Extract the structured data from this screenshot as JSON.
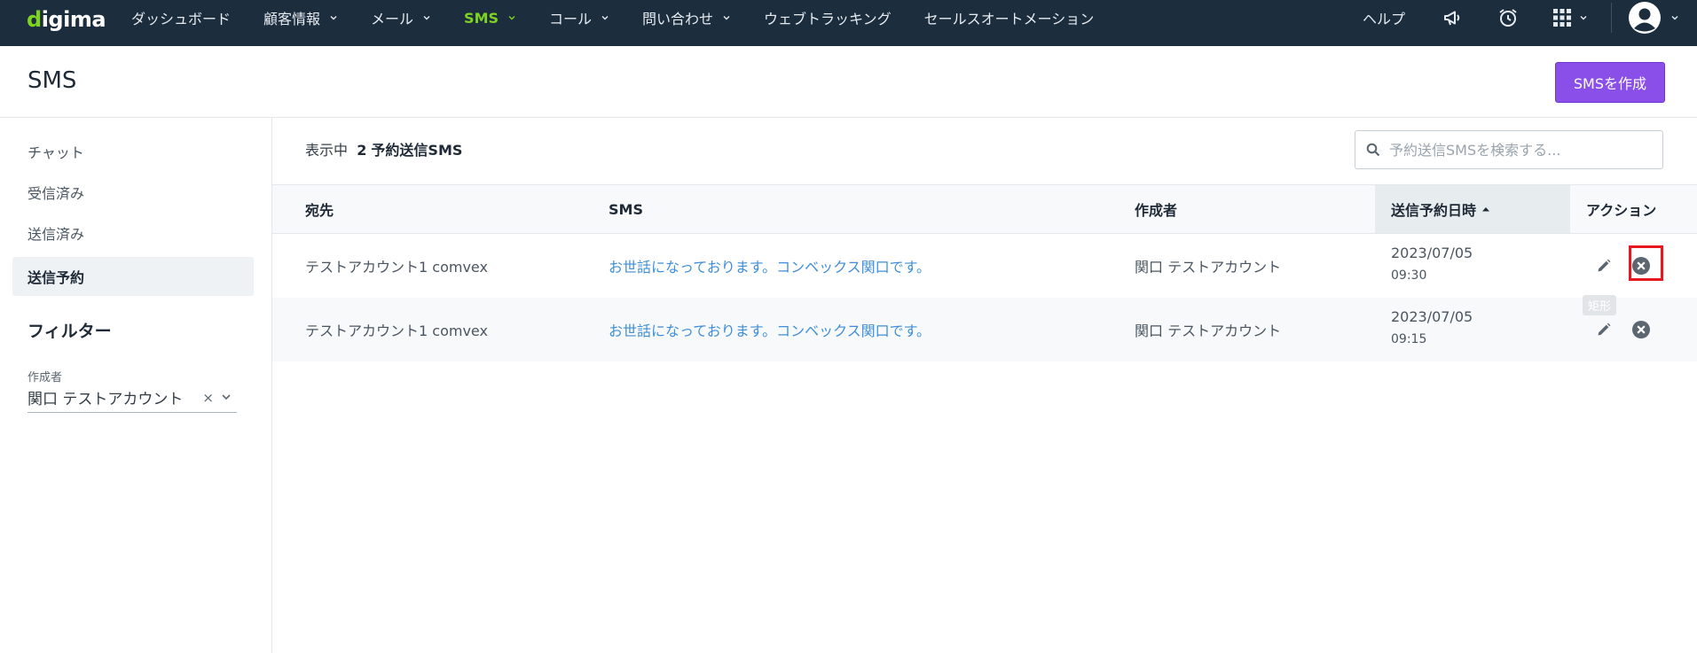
{
  "app": {
    "logo": "digima",
    "logo_dot": "d",
    "nav": [
      {
        "label": "ダッシュボード",
        "has_menu": false,
        "active": false
      },
      {
        "label": "顧客情報",
        "has_menu": true,
        "active": false
      },
      {
        "label": "メール",
        "has_menu": true,
        "active": false
      },
      {
        "label": "SMS",
        "has_menu": true,
        "active": true
      },
      {
        "label": "コール",
        "has_menu": true,
        "active": false
      },
      {
        "label": "問い合わせ",
        "has_menu": true,
        "active": false
      },
      {
        "label": "ウェブトラッキング",
        "has_menu": false,
        "active": false
      },
      {
        "label": "セールスオートメーション",
        "has_menu": false,
        "active": false
      }
    ],
    "help_label": "ヘルプ",
    "icons": [
      "megaphone-icon",
      "alarm-clock-icon",
      "apps-grid-icon",
      "user-avatar-icon"
    ],
    "colors": {
      "nav_bg": "#1c2d3e",
      "active": "#7ed321",
      "primary_button": "#8a4fe8",
      "link": "#3f8ed8",
      "highlight": "#e5191f"
    }
  },
  "page": {
    "title": "SMS",
    "create_button": "SMSを作成"
  },
  "sidebar": {
    "items": [
      {
        "label": "チャット",
        "active": false
      },
      {
        "label": "受信済み",
        "active": false
      },
      {
        "label": "送信済み",
        "active": false
      },
      {
        "label": "送信予約",
        "active": true
      }
    ],
    "filter_title": "フィルター",
    "filter_label": "作成者",
    "filter_value": "関口 テストアカウント",
    "filter_clear": "×"
  },
  "main": {
    "showing_prefix": "表示中",
    "showing_count": "2",
    "showing_suffix": "予約送信SMS",
    "search_placeholder": "予約送信SMSを検索する...",
    "columns": [
      "宛先",
      "SMS",
      "作成者",
      "送信予約日時",
      "アクション"
    ],
    "sorted_column": "送信予約日時",
    "sort_direction": "ascending",
    "rows": [
      {
        "recipient": "テストアカウント1 comvex",
        "sms": "お世話になっております。コンベックス関口です。",
        "author": "関口 テストアカウント",
        "date": "2023/07/05",
        "time": "09:30"
      },
      {
        "recipient": "テストアカウント1 comvex",
        "sms": "お世話になっております。コンベックス関口です。",
        "author": "関口 テストアカウント",
        "date": "2023/07/05",
        "time": "09:15"
      }
    ],
    "tooltip": "矩形"
  }
}
